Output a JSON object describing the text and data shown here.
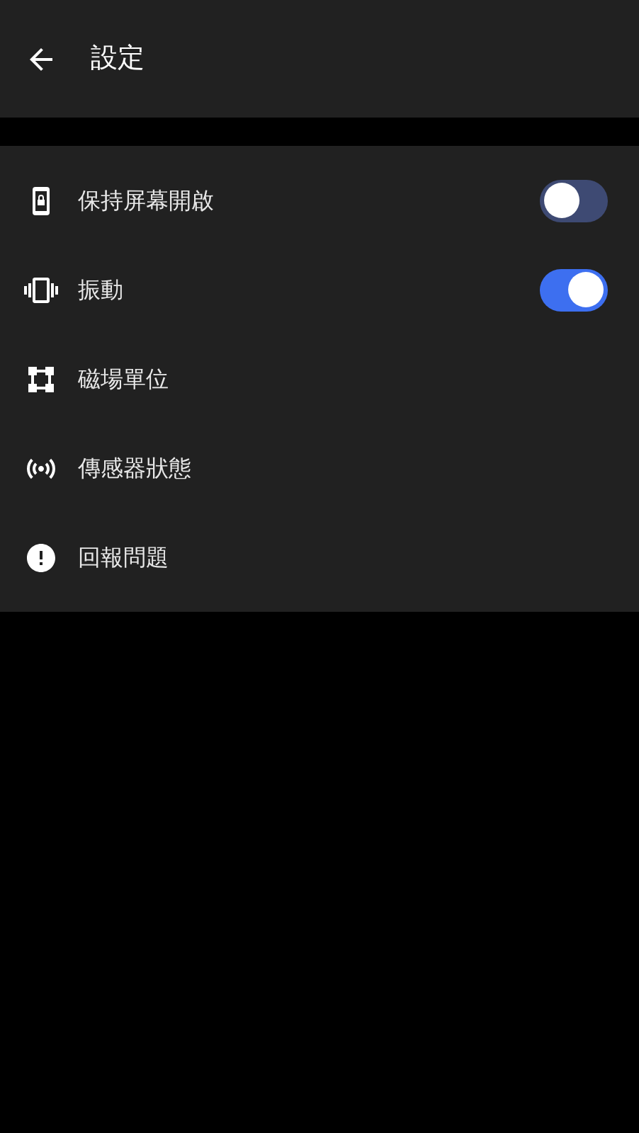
{
  "header": {
    "title": "設定"
  },
  "items": [
    {
      "kind": "toggle",
      "label": "保持屏幕開啟",
      "on": false
    },
    {
      "kind": "toggle",
      "label": "振動",
      "on": true
    },
    {
      "kind": "link",
      "label": "磁場單位"
    },
    {
      "kind": "link",
      "label": "傳感器狀態"
    },
    {
      "kind": "link",
      "label": "回報問題"
    }
  ]
}
